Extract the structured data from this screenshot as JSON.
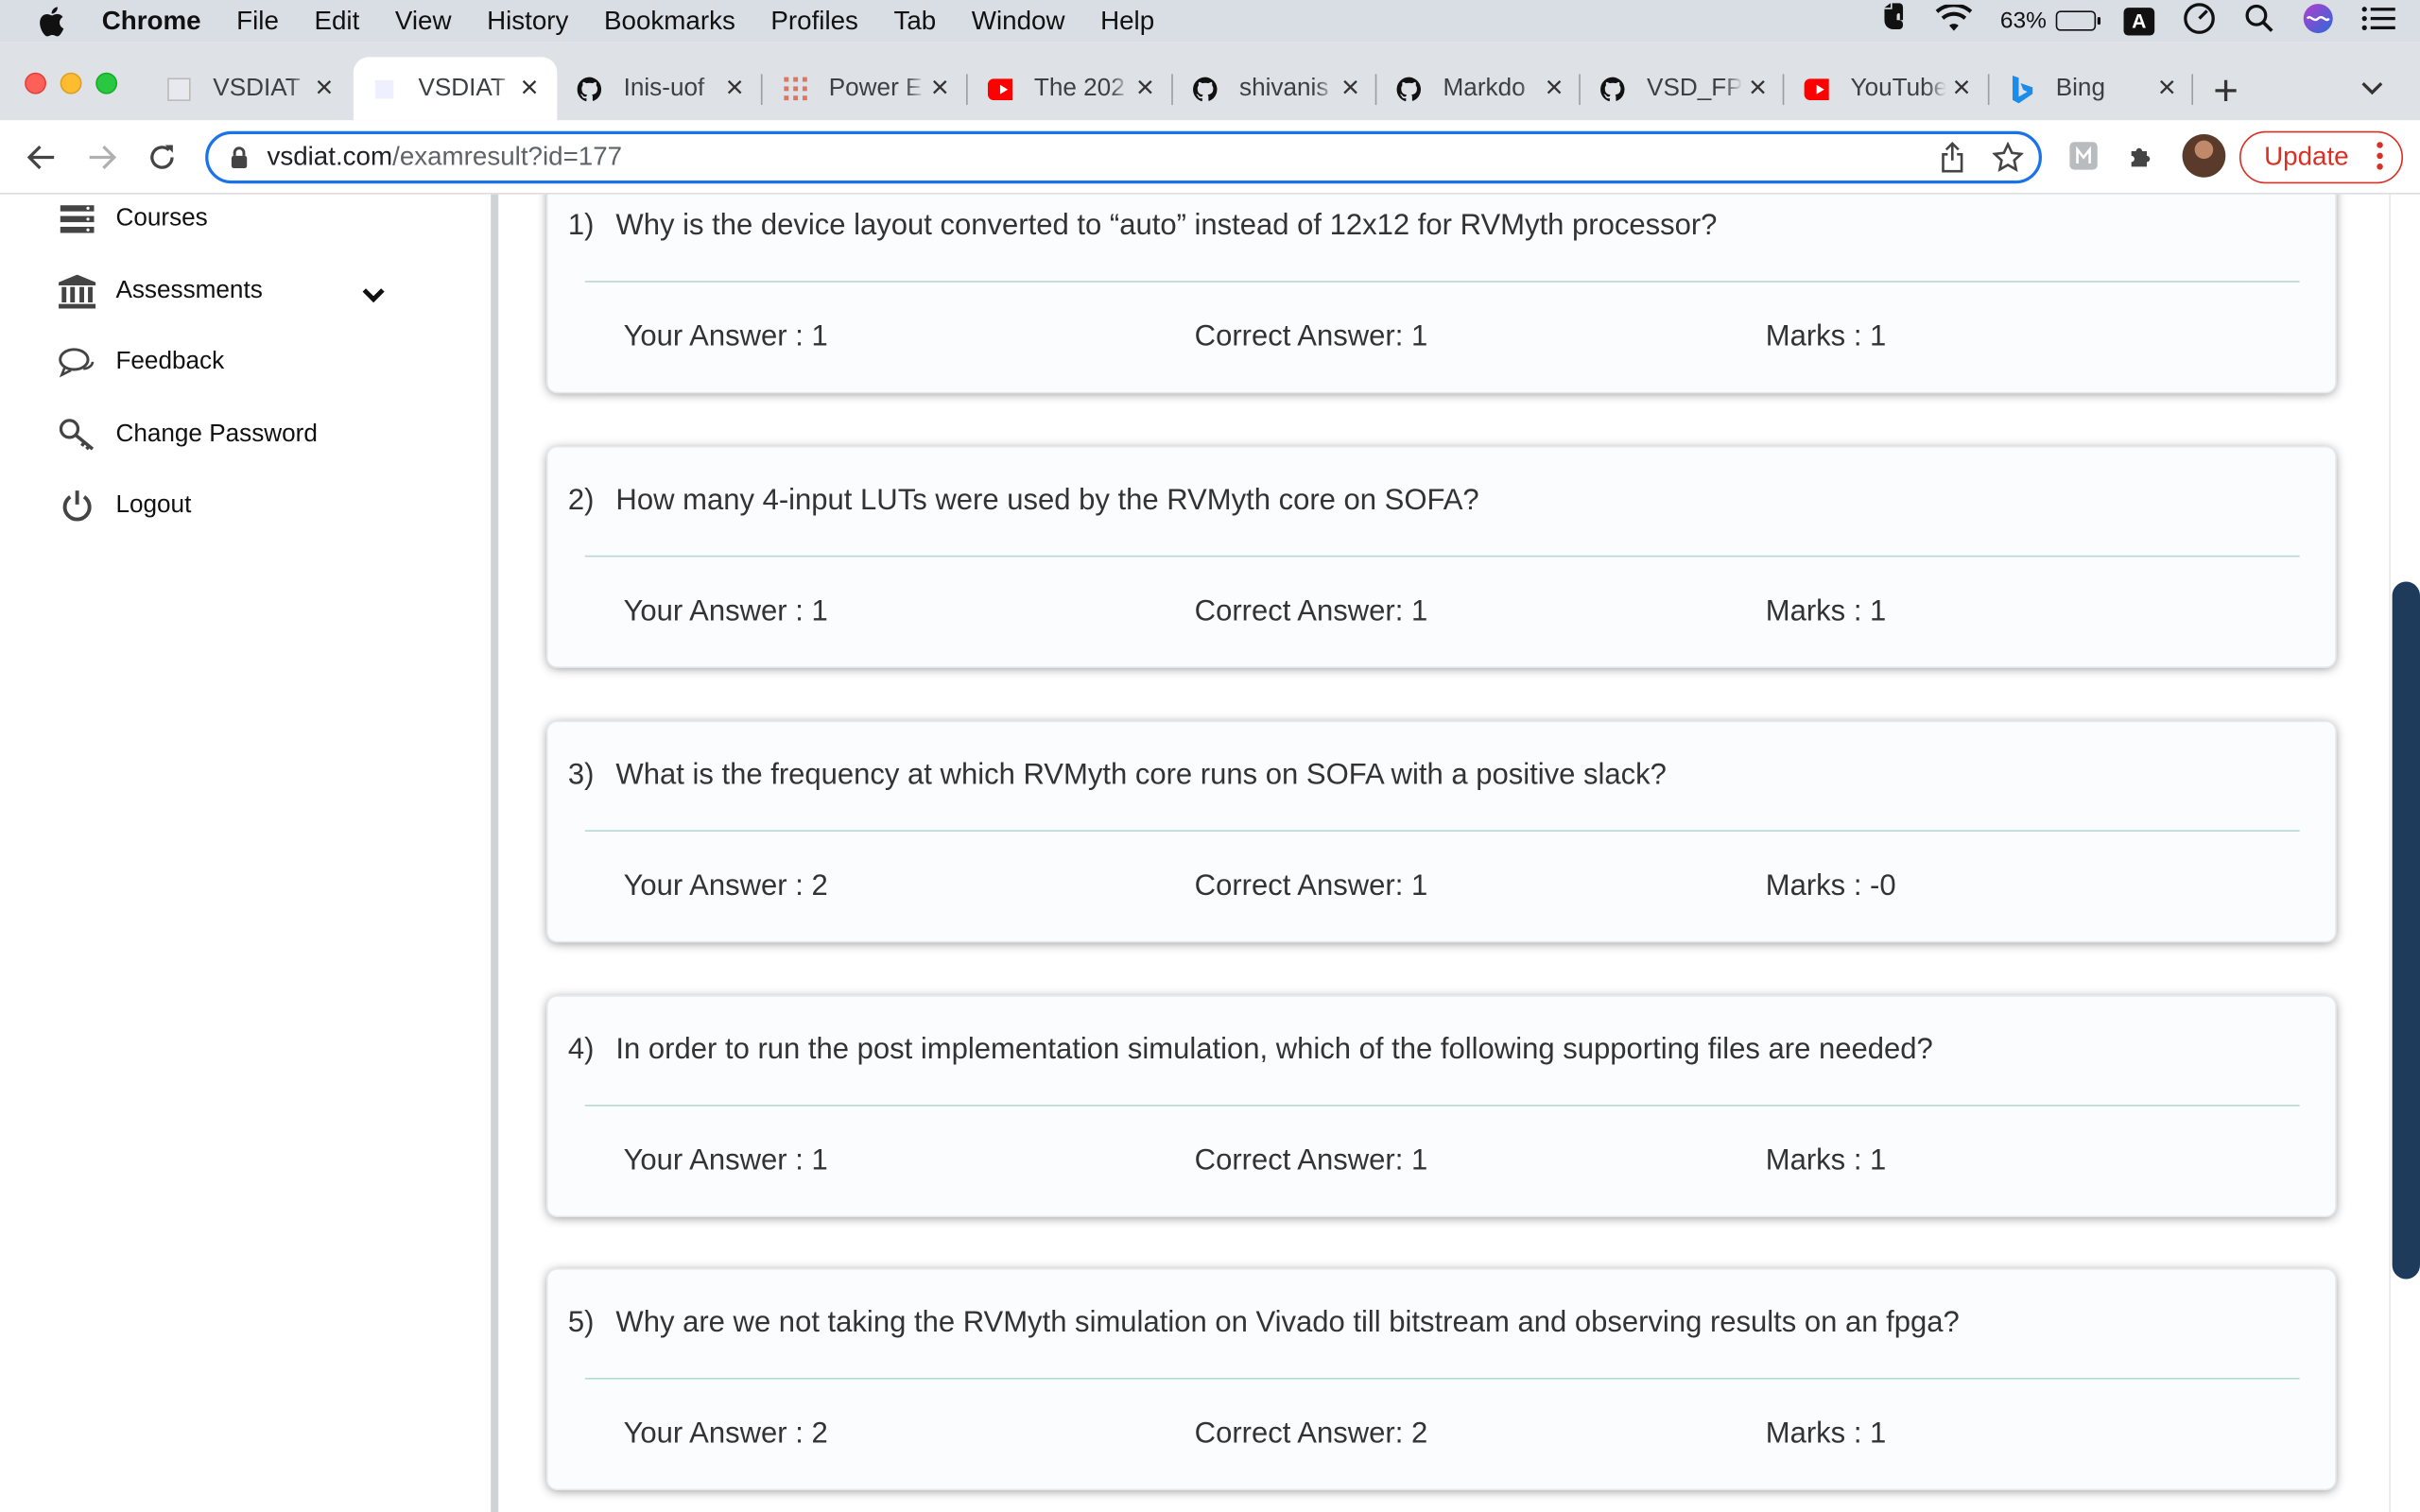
{
  "menubar": {
    "app": "Chrome",
    "items": [
      "File",
      "Edit",
      "View",
      "History",
      "Bookmarks",
      "Profiles",
      "Tab",
      "Window",
      "Help"
    ],
    "battery": "63%",
    "battery_level": 0.63,
    "input_source": "A"
  },
  "tabs": [
    {
      "label": "VSDIAT",
      "icon": "vsdiat-icon"
    },
    {
      "label": "VSDIAT",
      "icon": "vsdiat-icon",
      "active": true
    },
    {
      "label": "Inis-uof",
      "icon": "github-icon"
    },
    {
      "label": "Power E",
      "icon": "powerbi-icon"
    },
    {
      "label": "The 202",
      "icon": "youtube-icon"
    },
    {
      "label": "shivanis",
      "icon": "github-icon"
    },
    {
      "label": "Markdo",
      "icon": "github-icon"
    },
    {
      "label": "VSD_FP",
      "icon": "github-icon"
    },
    {
      "label": "YouTube",
      "icon": "youtube-icon"
    },
    {
      "label": "Bing",
      "icon": "bing-icon"
    }
  ],
  "toolbar": {
    "url_host": "vsdiat.com",
    "url_path": "/examresult?id=177",
    "update_label": "Update"
  },
  "sidebar": {
    "items": [
      {
        "label": "Courses",
        "icon": "courses-icon"
      },
      {
        "label": "Assessments",
        "icon": "bank-icon"
      },
      {
        "label": "Feedback",
        "icon": "chat-icon"
      },
      {
        "label": "Change Password",
        "icon": "key-icon"
      },
      {
        "label": "Logout",
        "icon": "power-icon"
      }
    ]
  },
  "results": [
    {
      "num": "1)",
      "question": "Why is the device layout converted to “auto” instead of 12x12 for RVMyth processor?",
      "your_answer": "Your Answer : 1",
      "correct_answer": "Correct Answer: 1",
      "marks": "Marks : 1"
    },
    {
      "num": "2)",
      "question": "How many 4-input LUTs were used by the RVMyth core on SOFA?",
      "your_answer": "Your Answer : 1",
      "correct_answer": "Correct Answer: 1",
      "marks": "Marks : 1"
    },
    {
      "num": "3)",
      "question": "What is the frequency at which RVMyth core runs on SOFA with a positive slack?",
      "your_answer": "Your Answer : 2",
      "correct_answer": "Correct Answer: 1",
      "marks": "Marks : -0"
    },
    {
      "num": "4)",
      "question": "In order to run the post implementation simulation, which of the following supporting files are needed?",
      "your_answer": "Your Answer : 1",
      "correct_answer": "Correct Answer: 1",
      "marks": "Marks : 1"
    },
    {
      "num": "5)",
      "question": "Why are we not taking the RVMyth simulation on Vivado till bitstream and observing results on an fpga?",
      "your_answer": "Your Answer : 2",
      "correct_answer": "Correct Answer: 2",
      "marks": "Marks : 1"
    }
  ]
}
